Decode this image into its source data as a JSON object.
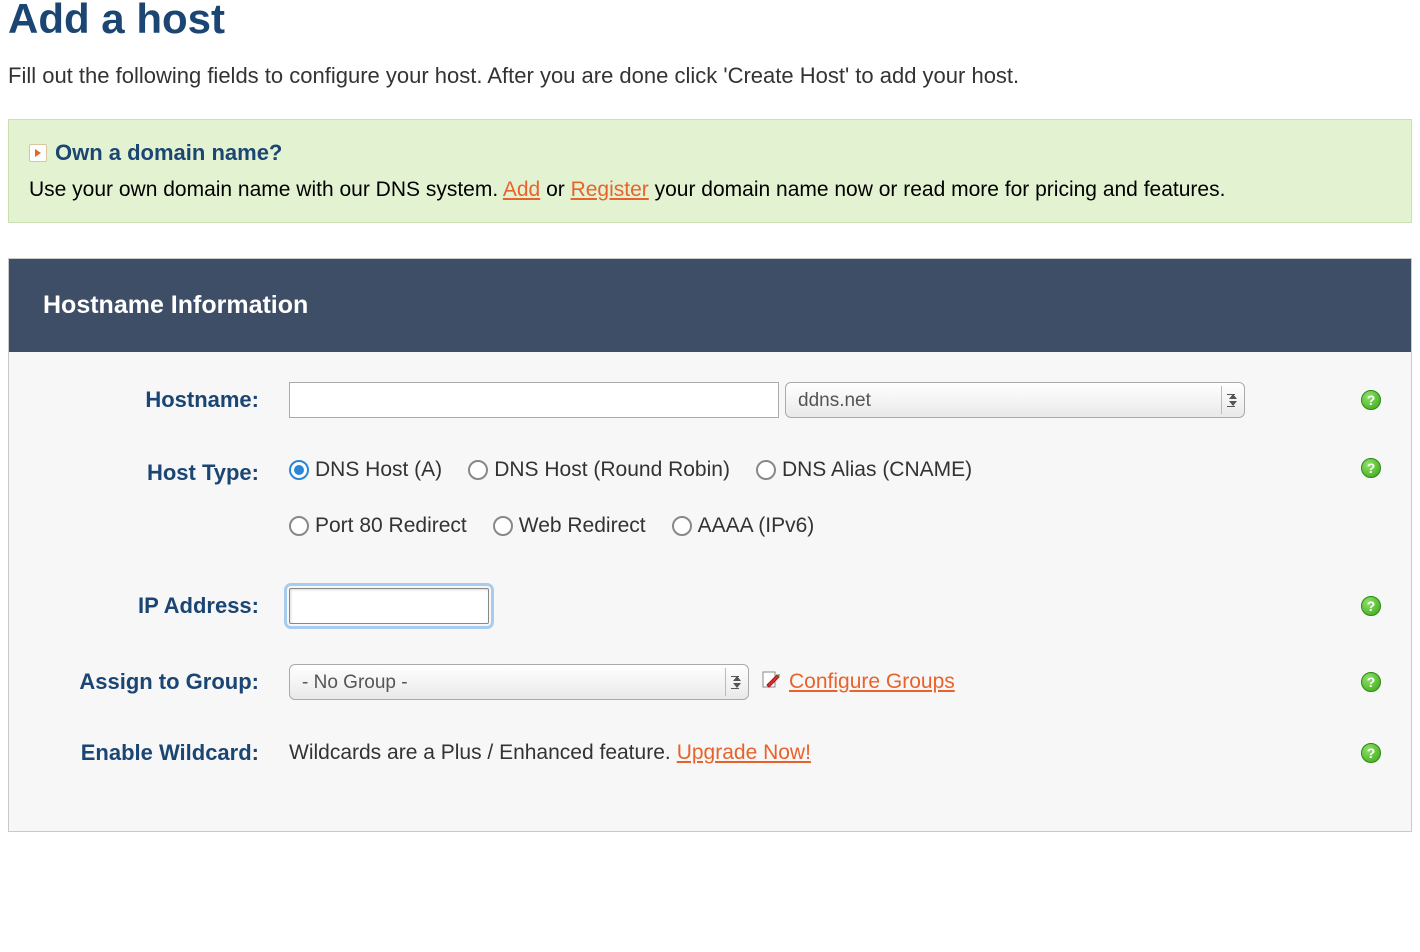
{
  "page": {
    "title": "Add a host",
    "subtitle": "Fill out the following fields to configure your host. After you are done click 'Create Host' to add your host."
  },
  "info": {
    "header": "Own a domain name?",
    "text_before": "Use your own domain name with our DNS system. ",
    "add_link": "Add",
    "or": " or ",
    "register_link": "Register",
    "text_after": " your domain name now or read more for pricing and features."
  },
  "panel": {
    "header": "Hostname Information"
  },
  "form": {
    "hostname_label": "Hostname:",
    "hostname_value": "",
    "domain_selected": "ddns.net",
    "hosttype_label": "Host Type:",
    "hosttypes": {
      "a": "DNS Host (A)",
      "rr": "DNS Host (Round Robin)",
      "cname": "DNS Alias (CNAME)",
      "port80": "Port 80 Redirect",
      "web": "Web Redirect",
      "aaaa": "AAAA (IPv6)"
    },
    "ip_label": "IP Address:",
    "ip_value": "",
    "group_label": "Assign to Group:",
    "group_selected": "- No Group -",
    "configure_groups": "Configure Groups",
    "wildcard_label": "Enable Wildcard:",
    "wildcard_text": "Wildcards are a Plus / Enhanced feature. ",
    "upgrade_link": "Upgrade Now!"
  }
}
